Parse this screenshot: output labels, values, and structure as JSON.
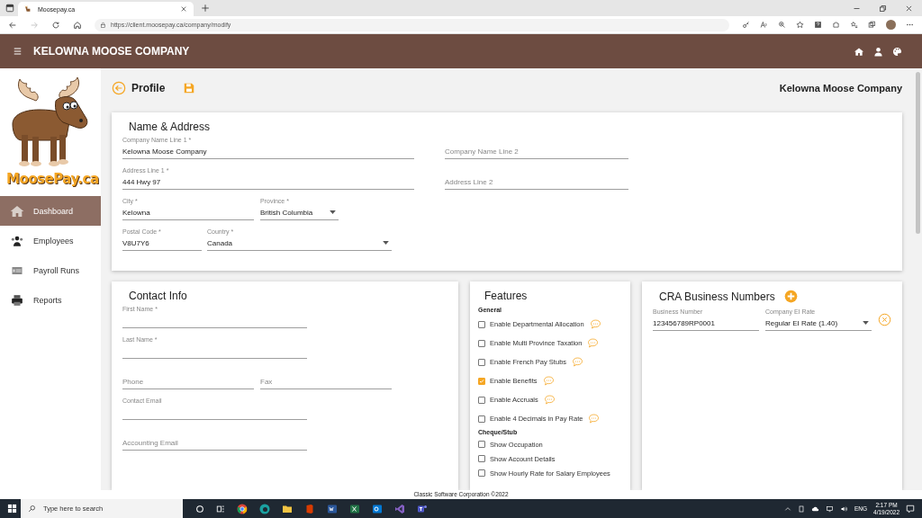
{
  "browser": {
    "tab_title": "Moosepay.ca",
    "url": "https://client.moosepay.ca/company/modify"
  },
  "header": {
    "title": "KELOWNA MOOSE COMPANY"
  },
  "sidebar": {
    "logo_text": "MoosePay.ca",
    "items": [
      {
        "label": "Dashboard",
        "selected": true
      },
      {
        "label": "Employees",
        "selected": false
      },
      {
        "label": "Payroll Runs",
        "selected": false
      },
      {
        "label": "Reports",
        "selected": false
      }
    ]
  },
  "page": {
    "title": "Profile",
    "company": "Kelowna Moose Company"
  },
  "name_address": {
    "title": "Name & Address",
    "rows": [
      [
        {
          "label": "Company Name Line 1 *",
          "value": "Kelowna Moose Company",
          "kind": "text"
        },
        {
          "placeholder": "Company Name Line 2",
          "kind": "text"
        }
      ],
      [
        {
          "label": "Address Line 1 *",
          "value": "444 Hwy 97",
          "kind": "text"
        },
        {
          "placeholder": "Address Line 2",
          "kind": "text"
        }
      ],
      [
        {
          "label": "City *",
          "value": "Kelowna",
          "kind": "text"
        },
        {
          "label": "Province *",
          "value": "British Columbia",
          "kind": "select"
        }
      ],
      [
        {
          "label": "Postal Code *",
          "value": "V8U7Y6",
          "kind": "text"
        },
        {
          "label": "Country *",
          "value": "Canada",
          "kind": "select"
        }
      ]
    ]
  },
  "contact_info": {
    "title": "Contact Info",
    "rows": [
      [
        {
          "label": "First Name *",
          "kind": "text"
        }
      ],
      [
        {
          "label": "Last Name *",
          "kind": "text"
        }
      ],
      [
        {
          "placeholder": "Phone",
          "kind": "text"
        },
        {
          "placeholder": "Fax",
          "kind": "text"
        }
      ],
      [
        {
          "label": "Contact Email",
          "kind": "text"
        }
      ],
      [
        {
          "placeholder": "Accounting Email",
          "kind": "text"
        }
      ]
    ]
  },
  "features": {
    "title": "Features",
    "sections": [
      {
        "heading": "General",
        "items": [
          {
            "label": "Enable Departmental Allocation",
            "checked": false,
            "help": true
          },
          {
            "label": "Enable Multi Province Taxation",
            "checked": false,
            "help": true
          },
          {
            "label": "Enable French Pay Stubs",
            "checked": false,
            "help": true
          },
          {
            "label": "Enable Benefits",
            "checked": true,
            "help": true
          },
          {
            "label": "Enable Accruals",
            "checked": false,
            "help": true
          },
          {
            "label": "Enable 4 Decimals in Pay Rate",
            "checked": false,
            "help": true
          }
        ]
      },
      {
        "heading": "Cheque/Stub",
        "items": [
          {
            "label": "Show Occupation",
            "checked": false,
            "help": false
          },
          {
            "label": "Show Account Details",
            "checked": false,
            "help": false
          },
          {
            "label": "Show Hourly Rate for Salary Employees",
            "checked": false,
            "help": false
          }
        ]
      }
    ]
  },
  "cra_business_numbers": {
    "title": "CRA Business Numbers",
    "rows": [
      [
        {
          "label": "Business Number",
          "value": "123456789RP0001",
          "kind": "text"
        },
        {
          "label": "Company EI Rate",
          "value": "Regular EI Rate (1.40)",
          "kind": "select"
        }
      ]
    ]
  },
  "footer": {
    "text": "Classic Software Corporation ©2022"
  },
  "taskbar": {
    "search_placeholder": "Type here to search",
    "language": "ENG",
    "time": "2:17 PM",
    "date": "4/19/2022"
  }
}
